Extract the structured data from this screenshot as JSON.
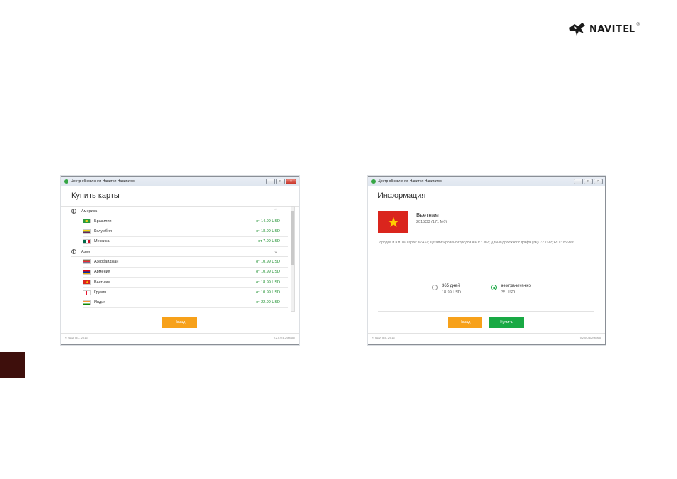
{
  "brand": {
    "name": "NAVITEL",
    "mark": "®"
  },
  "left_window": {
    "title": "Центр обновления Навител Навигатор",
    "heading": "Купить карты",
    "groups": [
      {
        "label": "Америка",
        "rows": [
          {
            "name": "Бразилия",
            "price": "от 14.99 USD"
          },
          {
            "name": "Колумбия",
            "price": "от 18.99 USD"
          },
          {
            "name": "Мексика",
            "price": "от 7.99 USD"
          }
        ]
      },
      {
        "label": "Азия",
        "rows": [
          {
            "name": "Азербайджан",
            "price": "от 10.99 USD"
          },
          {
            "name": "Армения",
            "price": "от 10.99 USD"
          },
          {
            "name": "Вьетнам",
            "price": "от 18.99 USD"
          },
          {
            "name": "Грузия",
            "price": "от 10.99 USD"
          },
          {
            "name": "Индия",
            "price": "от 22.99 USD"
          }
        ]
      }
    ],
    "back_label": "Назад",
    "copyright": "© NAVITEL, 2016",
    "version": "v.2.0.0.6.29cfa5c"
  },
  "right_window": {
    "title": "Центр обновления Навител Навигатор",
    "heading": "Информация",
    "country": "Вьетнам",
    "map_version": "2015Q3 (171 Мб)",
    "description": "Городов и н.п. на карте: 67432; Детализировано городов и н.п.: 762; Длина дорожного графа (км): 337638; POI: 156366",
    "option1_label": "365 дней",
    "option1_price": "18.99 USD",
    "option2_label": "неограниченно",
    "option2_price": "25 USD",
    "back_label": "Назад",
    "buy_label": "Купить",
    "copyright": "© NAVITEL, 2016",
    "version": "v.2.0.0.6.29cfa5c"
  },
  "colors": {
    "accent_orange": "#f7a11a",
    "accent_green": "#19a944",
    "price_green": "#1b8f2d",
    "side_tab": "#3e0f0c"
  }
}
